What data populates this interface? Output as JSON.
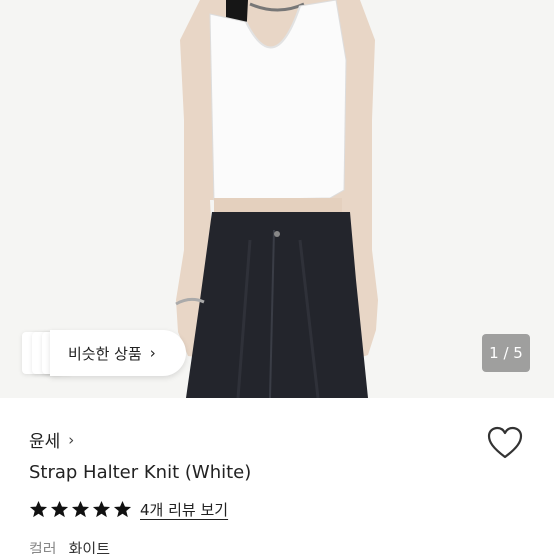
{
  "gallery": {
    "similar_label": "비슷한 상품",
    "similar_chevron": "›",
    "counter": "1 / 5"
  },
  "product": {
    "brand": "윤세",
    "brand_chevron": "›",
    "title": "Strap Halter Knit (White)",
    "rating": 5,
    "review_link": "4개 리뷰 보기",
    "color_label": "컬러",
    "color_value": "화이트"
  },
  "icons": {
    "wishlist": "heart-outline-icon",
    "star": "star-filled-icon"
  },
  "colors": {
    "background": "#ffffff",
    "photo_bg": "#f5f5f3",
    "star": "#111111",
    "muted_text": "#888888"
  }
}
